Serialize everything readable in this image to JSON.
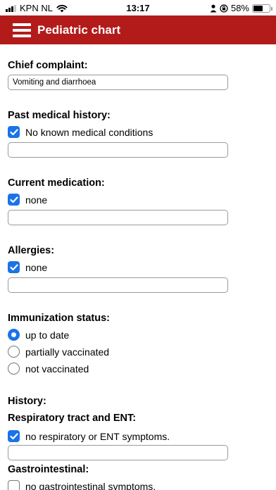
{
  "status_bar": {
    "carrier": "KPN NL",
    "time": "13:17",
    "battery_percent": "58%",
    "battery_level": 0.58,
    "icons": [
      "signal-icon",
      "wifi-icon",
      "person-icon",
      "orientation-lock-icon",
      "battery-icon"
    ]
  },
  "header": {
    "title": "Pediatric chart",
    "menu_icon": "hamburger-menu-icon",
    "background_color": "#b31b1b"
  },
  "form": {
    "chief_complaint": {
      "label": "Chief complaint:",
      "value": "Vomiting and diarrhoea"
    },
    "past_medical_history": {
      "label": "Past medical history:",
      "option": "No known medical conditions",
      "checked": true,
      "value": ""
    },
    "current_medication": {
      "label": "Current medication:",
      "option": "none",
      "checked": true,
      "value": ""
    },
    "allergies": {
      "label": "Allergies:",
      "option": "none",
      "checked": true,
      "value": ""
    },
    "immunization": {
      "label": "Immunization status:",
      "options": [
        "up to date",
        "partially vaccinated",
        "not vaccinated"
      ],
      "selected": "up to date"
    },
    "history": {
      "label": "History:",
      "respiratory": {
        "label": "Respiratory tract and ENT:",
        "option": "no respiratory or ENT symptoms.",
        "checked": true,
        "value": ""
      },
      "gastrointestinal": {
        "label": "Gastrointestinal:",
        "option": "no gastrointestinal symptoms.",
        "checked": false
      }
    }
  },
  "accent_color": "#1a73e8"
}
